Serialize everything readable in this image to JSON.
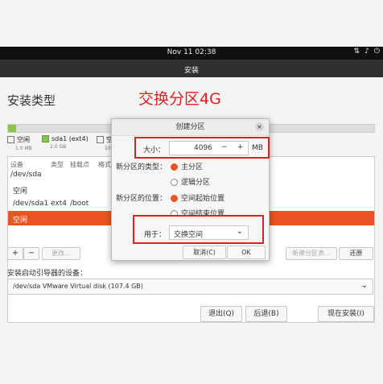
{
  "system": {
    "clock": "Nov 11  02:38",
    "tray_icons": [
      "network-icon",
      "volume-icon",
      "power-icon"
    ]
  },
  "window": {
    "title": "安装"
  },
  "page": {
    "heading": "安装类型",
    "annotation": "交换分区4G"
  },
  "partition_bar": {
    "legend": [
      {
        "label": "空闲",
        "size": "1.0 MB"
      },
      {
        "label": "sda1 (ext4)",
        "size": "2.0 GB"
      },
      {
        "label": "空",
        "size": "10"
      }
    ]
  },
  "table": {
    "headers": [
      "设备",
      "类型",
      "挂载点",
      "格式"
    ],
    "rows": [
      {
        "device": "/dev/sda",
        "type": "",
        "mount": ""
      },
      {
        "device": "空闲",
        "type": "",
        "mount": ""
      },
      {
        "device": "/dev/sda1",
        "type": "ext4",
        "mount": "/boot"
      },
      {
        "device": "空闲",
        "type": "",
        "mount": "",
        "selected": true
      }
    ]
  },
  "table_controls": {
    "add": "+",
    "remove": "−",
    "change": "更改...",
    "new_table": "新建分区表...",
    "revert": "还原"
  },
  "boot": {
    "label": "安装启动引导器的设备：",
    "value": "/dev/sda   VMware Virtual disk (107.4 GB)"
  },
  "footer": {
    "quit": "退出(Q)",
    "back": "后退(B)",
    "install_now": "现在安装(I)"
  },
  "dialog": {
    "title": "创建分区",
    "size_label": "大小：",
    "size_value": "4096",
    "size_unit": "MB",
    "minus": "−",
    "plus": "+",
    "type_label": "新分区的类型：",
    "type_options": [
      "主分区",
      "逻辑分区"
    ],
    "location_label": "新分区的位置：",
    "location_options": [
      "空间起始位置",
      "空间结束位置"
    ],
    "use_label": "用于：",
    "use_value": "交换空间",
    "cancel": "取消(C)",
    "ok": "OK"
  },
  "colors": {
    "accent": "#e95420",
    "annotation_red": "#e02020",
    "partition_green": "#8ac44a"
  }
}
